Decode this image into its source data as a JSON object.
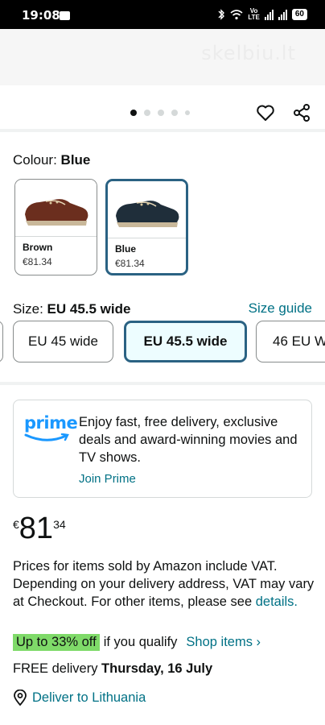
{
  "status_bar": {
    "time": "19:08",
    "volte_top": "Vo",
    "volte_bottom": "LTE",
    "battery": "60"
  },
  "banner": {
    "watermark": "skelbiu.lt"
  },
  "gallery": {
    "dot_count": 5,
    "active_index": 0
  },
  "colour": {
    "label": "Colour:",
    "selected": "Blue",
    "options": [
      {
        "name": "Brown",
        "price": "€81.34",
        "color": "#6b2e1e"
      },
      {
        "name": "Blue",
        "price": "€81.34",
        "color": "#1f2e3a"
      }
    ]
  },
  "size": {
    "label": "Size:",
    "selected": "EU 45.5 wide",
    "guide_link": "Size guide",
    "options": [
      "EU 45 wide",
      "EU 45.5 wide",
      "46 EU W"
    ]
  },
  "prime": {
    "logo": "prime",
    "text": "Enjoy fast, free delivery, exclusive deals and award-winning movies and TV shows.",
    "join_link": "Join Prime"
  },
  "price": {
    "symbol": "€",
    "whole": "81",
    "fraction": "34"
  },
  "vat": {
    "text": "Prices for items sold by Amazon include VAT. Depending on your delivery address, VAT may vary at Checkout. For other items, please see ",
    "link": "details."
  },
  "deal": {
    "badge": "Up to 33% off",
    "qualifier": "if you qualify",
    "link": "Shop items ›"
  },
  "delivery": {
    "prefix": "FREE delivery ",
    "date": "Thursday, 16 July"
  },
  "deliver_to": {
    "label": "Deliver to Lithuania"
  },
  "colors": {
    "accent_link": "#007185",
    "selected_border": "#2a6283",
    "deal_green": "#7fda69",
    "prime_blue": "#1a98ff"
  }
}
